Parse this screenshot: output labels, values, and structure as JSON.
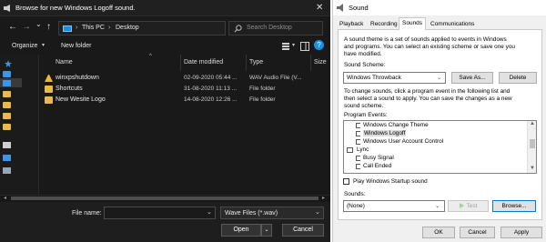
{
  "browse_dialog": {
    "title": "Browse for new Windows Logoff sound.",
    "close_glyph": "✕",
    "nav": {
      "back_glyph": "←",
      "forward_glyph": "→",
      "recent_glyph": "⌄",
      "up_glyph": "↑",
      "address": [
        "This PC",
        "Desktop"
      ],
      "separator_glyph": "›",
      "search_placeholder": "Search Desktop"
    },
    "command_bar": {
      "organize_label": "Organize",
      "organize_caret": "▾",
      "new_folder_label": "New folder",
      "view_caret": "▾",
      "help_glyph": "?"
    },
    "columns": {
      "name": "Name",
      "date_modified": "Date modified",
      "type": "Type",
      "size": "Size",
      "sort_caret": "^"
    },
    "files": [
      {
        "name": "winxpshutdown",
        "date": "02-09-2020 05:44 ...",
        "type": "WAV Audio File (V...",
        "size": "",
        "icon": "audio-file-icon"
      },
      {
        "name": "Shortcuts",
        "date": "31-08-2020 11:13 ...",
        "type": "File folder",
        "size": "",
        "icon": "folder-icon"
      },
      {
        "name": "New Wesite Logo",
        "date": "14-08-2020 12:26 ...",
        "type": "File folder",
        "size": "",
        "icon": "folder-icon"
      }
    ],
    "footer": {
      "file_name_label": "File name:",
      "file_name_value": "",
      "file_type_value": "Wave Files (*.wav)",
      "open_label": "Open",
      "cancel_label": "Cancel",
      "dropdown_glyph": "⌄"
    },
    "colors": {
      "background": "#191919",
      "text": "#e6e6e6",
      "folder": "#e9b94a",
      "accent": "#1a8fe3"
    }
  },
  "sound_dialog": {
    "title": "Sound",
    "tabs": [
      {
        "label": "Playback",
        "active": false
      },
      {
        "label": "Recording",
        "active": false
      },
      {
        "label": "Sounds",
        "active": true
      },
      {
        "label": "Communications",
        "active": false
      }
    ],
    "intro_lines": [
      "A sound theme is a set of sounds applied to events in Windows",
      "and programs.  You can select an existing scheme or save one you",
      "have modified."
    ],
    "scheme_label": "Sound Scheme:",
    "scheme_value": "Windows Throwback",
    "save_as_label": "Save As...",
    "delete_label": "Delete",
    "help_lines": [
      "To change sounds, click a program event in the following list and",
      "then select a sound to apply.  You can save the changes as a new",
      "sound scheme."
    ],
    "program_events_label": "Program Events:",
    "events": [
      {
        "label": "Windows Change Theme",
        "kind": "event",
        "selected": false
      },
      {
        "label": "Windows Logoff",
        "kind": "event",
        "selected": true
      },
      {
        "label": "Windows User Account Control",
        "kind": "event",
        "selected": false
      },
      {
        "label": "Lync",
        "kind": "group",
        "selected": false
      },
      {
        "label": "Busy Signal",
        "kind": "event",
        "selected": false
      },
      {
        "label": "Call Ended",
        "kind": "event",
        "selected": false
      }
    ],
    "startup_label": "Play Windows Startup sound",
    "startup_checked": false,
    "sounds_label": "Sounds:",
    "sounds_value": "(None)",
    "test_label": "Test",
    "browse_label": "Browse...",
    "ok_label": "OK",
    "cancel_label": "Cancel",
    "apply_label": "Apply",
    "dropdown_glyph": "⌄",
    "scroll_up_glyph": "▲",
    "scroll_down_glyph": "▼"
  }
}
